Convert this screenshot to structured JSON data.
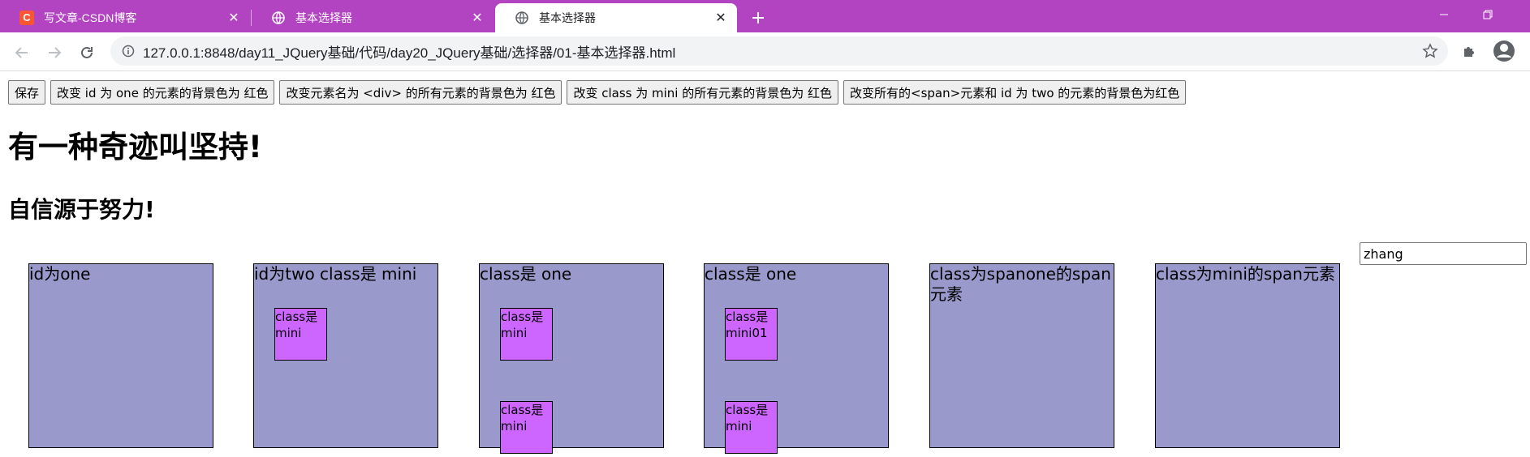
{
  "browser": {
    "tabs": [
      {
        "title": "写文章-CSDN博客",
        "icon": "csdn-icon",
        "active": false
      },
      {
        "title": "基本选择器",
        "icon": "globe-icon",
        "active": false
      },
      {
        "title": "基本选择器",
        "icon": "globe-icon",
        "active": true
      }
    ],
    "url": "127.0.0.1:8848/day11_JQuery基础/代码/day20_JQuery基础/选择器/01-基本选择器.html",
    "tab_bar_color": "#b244c1"
  },
  "page": {
    "buttons": [
      {
        "label": "保存"
      },
      {
        "label": "改变 id 为 one 的元素的背景色为 红色"
      },
      {
        "label": "改变元素名为 <div> 的所有元素的背景色为 红色"
      },
      {
        "label": "改变 class 为 mini 的所有元素的背景色为 红色"
      },
      {
        "label": "改变所有的<span>元素和 id 为 two 的元素的背景色为红色"
      }
    ],
    "heading1": "有一种奇迹叫坚持!",
    "heading2": "自信源于努力!",
    "input_value": "zhang",
    "boxes": [
      {
        "label": "id为one",
        "minis": []
      },
      {
        "label": "id为two class是 mini",
        "minis": [
          {
            "label": "class是 mini"
          }
        ]
      },
      {
        "label": "class是 one",
        "minis": [
          {
            "label": "class是 mini"
          },
          {
            "label": "class是 mini"
          }
        ]
      },
      {
        "label": "class是 one",
        "minis": [
          {
            "label": "class是 mini01"
          },
          {
            "label": "class是 mini"
          }
        ]
      },
      {
        "label": "class为spanone的span元素",
        "minis": []
      },
      {
        "label": "class为mini的span元素",
        "minis": []
      }
    ],
    "colors": {
      "box": "#9999cc",
      "mini": "#cc66ff"
    }
  }
}
